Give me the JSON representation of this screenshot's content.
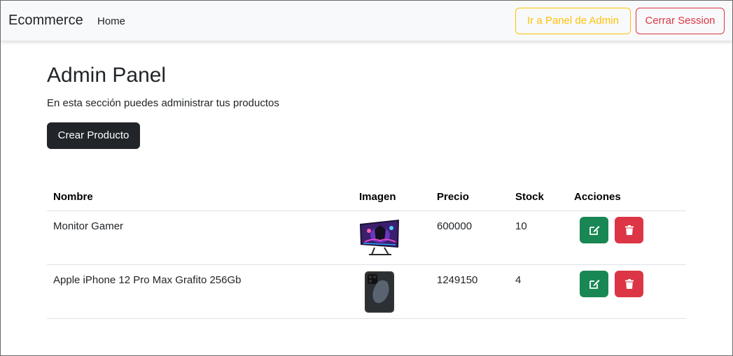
{
  "navbar": {
    "brand": "Ecommerce",
    "home_link": "Home",
    "admin_button": "Ir a Panel de Admin",
    "logout_button": "Cerrar Session"
  },
  "main": {
    "title": "Admin Panel",
    "subtitle": "En esta sección puedes administrar tus productos",
    "create_button": "Crear Producto"
  },
  "table": {
    "headers": [
      "Nombre",
      "Imagen",
      "Precio",
      "Stock",
      "Acciones"
    ],
    "rows": [
      {
        "nombre": "Monitor Gamer",
        "imagen_icon": "monitor-image",
        "precio": "600000",
        "stock": "10"
      },
      {
        "nombre": "Apple iPhone 12 Pro Max Grafito 256Gb",
        "imagen_icon": "iphone-image",
        "precio": "1249150",
        "stock": "4"
      }
    ]
  },
  "icons": {
    "edit": "edit-icon",
    "delete": "trash-icon"
  },
  "colors": {
    "navbar_bg": "#f8f9fa",
    "warning": "#ffc107",
    "danger": "#dc3545",
    "success": "#198754",
    "dark": "#212529"
  }
}
